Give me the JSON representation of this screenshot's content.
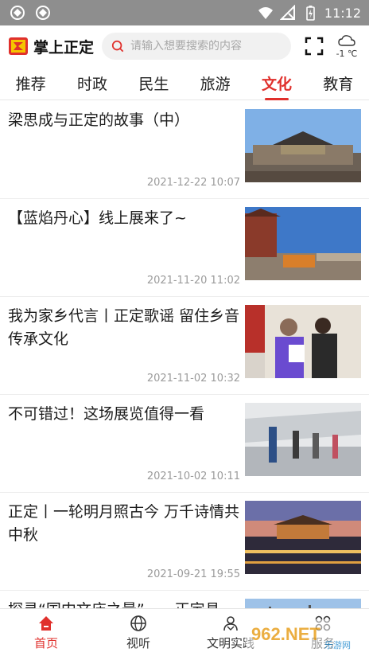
{
  "status_bar": {
    "time": "11:12"
  },
  "header": {
    "app_title": "掌上正定",
    "search_placeholder": "请输入想要搜索的内容",
    "weather_temp": "-1 ℃"
  },
  "tabs": [
    {
      "label": "推荐",
      "active": false
    },
    {
      "label": "时政",
      "active": false
    },
    {
      "label": "民生",
      "active": false
    },
    {
      "label": "旅游",
      "active": false
    },
    {
      "label": "文化",
      "active": true
    },
    {
      "label": "教育",
      "active": false
    }
  ],
  "articles": [
    {
      "title": "梁思成与正定的故事（中）",
      "date": "2021-12-22 10:07"
    },
    {
      "title": "【蓝焰丹心】线上展来了~",
      "date": "2021-11-20 11:02"
    },
    {
      "title": "我为家乡代言丨正定歌谣 留住乡音 传承文化",
      "date": "2021-11-02 10:32"
    },
    {
      "title": "不可错过！这场展览值得一看",
      "date": "2021-10-02 10:11"
    },
    {
      "title": "正定丨一轮明月照古今 万千诗情共中秋",
      "date": "2021-09-21 19:55"
    },
    {
      "title": "探寻“国内文庙之最”——正定县",
      "date": ""
    }
  ],
  "bottom_nav": [
    {
      "label": "首页",
      "icon": "home-icon",
      "active": true
    },
    {
      "label": "视听",
      "icon": "globe-icon",
      "active": false
    },
    {
      "label": "文明实践",
      "icon": "people-icon",
      "active": false
    },
    {
      "label": "服务",
      "icon": "grid-icon",
      "active": false
    }
  ],
  "watermark": {
    "text": "962.NET",
    "subtext": "乐游网"
  },
  "colors": {
    "accent": "#e0302c",
    "status_bar": "#8e8e8e"
  }
}
